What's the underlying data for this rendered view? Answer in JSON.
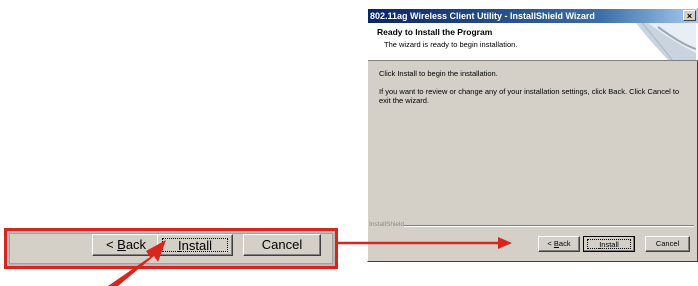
{
  "zoom_callout": {
    "back_label": "< Back",
    "install_label": "Install",
    "cancel_label": "Cancel"
  },
  "dialog": {
    "title": "802.11ag Wireless Client Utility - InstallShield Wizard",
    "close_glyph": "×",
    "header_title": "Ready to Install the Program",
    "header_subtitle": "The wizard is ready to begin installation.",
    "body_line1": "Click Install to begin the installation.",
    "body_line2": "If you want to review or change any of your installation settings, click Back. Click Cancel to exit the wizard.",
    "installshield_label": "InstallShield",
    "back_label": "< Back",
    "install_label": "Install",
    "cancel_label": "Cancel"
  },
  "colors": {
    "callout_red": "#d9251c",
    "titlebar_start": "#0a246a",
    "dialog_face": "#d4d0c8"
  },
  "icons": [
    "red-pointer-arrow-icon",
    "red-connector-arrow-icon",
    "wizard-header-graphic-icon"
  ]
}
